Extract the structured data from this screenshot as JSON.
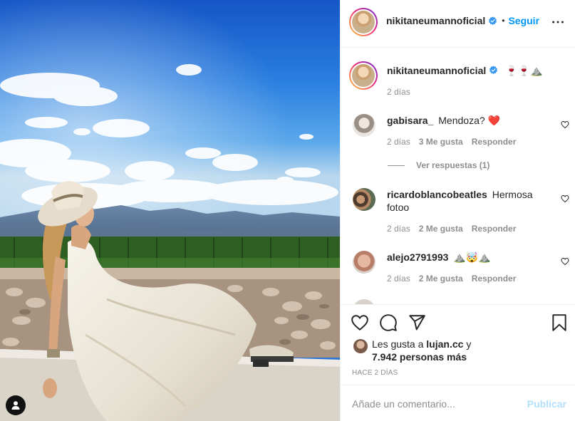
{
  "post": {
    "author": "nikitaneumannoficial",
    "follow_label": "Seguir",
    "separator": "•",
    "caption": {
      "username": "nikitaneumannoficial",
      "text": "🍷🍷⛰️",
      "time": "2 días"
    }
  },
  "comments": [
    {
      "username": "gabisara_",
      "text": "Mendoza? ❤️",
      "time": "2 días",
      "likes": "3 Me gusta",
      "reply_label": "Responder"
    },
    {
      "username": "ricardoblancobeatles",
      "text": "Hermosa fotoo",
      "time": "2 días",
      "likes": "2 Me gusta",
      "reply_label": "Responder"
    },
    {
      "username": "alejo2791993",
      "text": "⛰️🤯⛰️",
      "time": "2 días",
      "likes": "2 Me gusta",
      "reply_label": "Responder"
    }
  ],
  "view_replies": "Ver respuestas (1)",
  "likes": {
    "prefix": "Les gusta a",
    "liker": "lujan.cc",
    "conj": "y",
    "others": "7.942 personas más"
  },
  "time_ago": "HACE 2 DÍAS",
  "comment_box": {
    "placeholder": "Añade un comentario...",
    "publish_label": "Publicar"
  },
  "icons": {
    "header": [
      "verified-badge-icon",
      "more-options-icon"
    ],
    "actions": [
      "heart-icon",
      "comment-icon",
      "share-icon",
      "bookmark-icon"
    ],
    "photo": [
      "user-tag-icon"
    ]
  },
  "colors": {
    "accent": "#0095f6",
    "publish_disabled": "#b2dffc",
    "secondary_text": "#8e8e8e",
    "like_red": "#ed4956"
  }
}
